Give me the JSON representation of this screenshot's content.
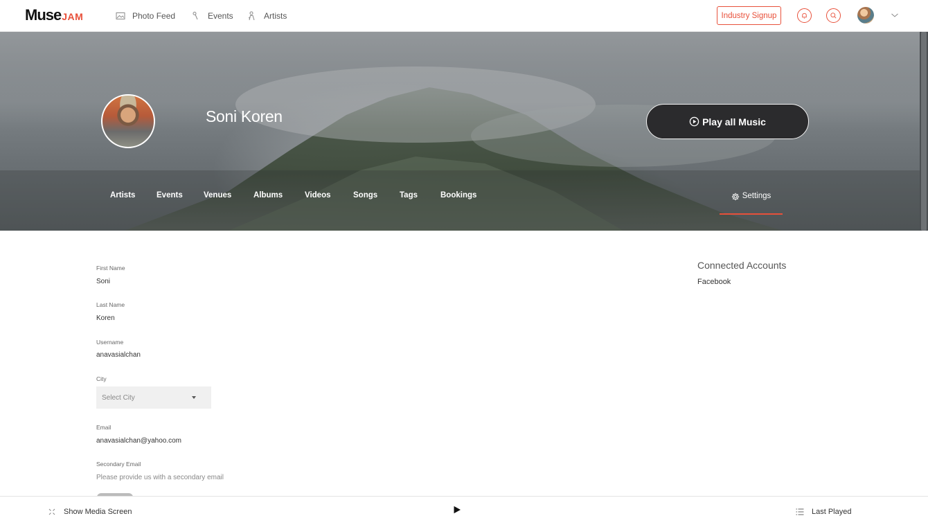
{
  "brand": {
    "logo_main": "Muse",
    "logo_accent": "JAM",
    "accent_color": "#e8503a"
  },
  "nav": {
    "items": [
      {
        "label": "Photo Feed",
        "icon": "image-icon"
      },
      {
        "label": "Events",
        "icon": "microphone-icon"
      },
      {
        "label": "Artists",
        "icon": "person-icon"
      }
    ],
    "industry_signup": "Industry Signup",
    "icons": [
      "bell-icon",
      "search-icon",
      "avatar",
      "chevron-down-icon"
    ]
  },
  "profile": {
    "name": "Soni Koren",
    "play_all": "Play all Music",
    "tabs": [
      "Artists",
      "Events",
      "Venues",
      "Albums",
      "Videos",
      "Songs",
      "Tags",
      "Bookings"
    ],
    "settings_tab": "Settings",
    "active_tab": "Settings"
  },
  "form": {
    "first_name": {
      "label": "First Name",
      "value": "Soni"
    },
    "last_name": {
      "label": "Last Name",
      "value": "Koren"
    },
    "username": {
      "label": "Username",
      "value": "anavasialchan"
    },
    "city": {
      "label": "City",
      "value": "Select City"
    },
    "email": {
      "label": "Email",
      "value": "anavasialchan@yahoo.com"
    },
    "secondary_email": {
      "label": "Secondary Email",
      "value": "Please provide us with a secondary email"
    }
  },
  "connected": {
    "title": "Connected Accounts",
    "accounts": [
      "Facebook"
    ]
  },
  "player": {
    "show_media": "Show Media Screen",
    "last_played": "Last Played"
  }
}
